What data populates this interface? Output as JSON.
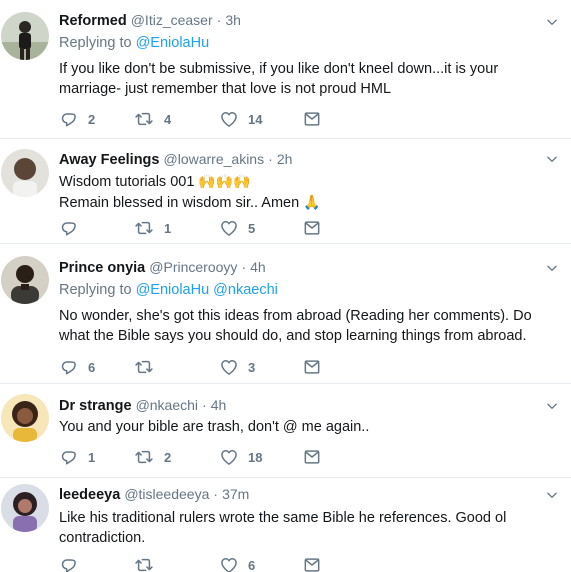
{
  "tweets": [
    {
      "name": "Reformed",
      "handle": "@Itiz_ceaser",
      "dot": "·",
      "time": "3h",
      "replying_prefix": "Replying to",
      "replying_to": "@EniolaHu",
      "text": "If you like don't be submissive, if you like don't kneel down...it is your marriage- just remember that love is not proud HML",
      "replies": "2",
      "retweets": "4",
      "likes": "14"
    },
    {
      "name": "Away Feelings",
      "handle": "@lowarre_akins",
      "dot": "·",
      "time": "2h",
      "line1": "Wisdom tutorials 001",
      "line1_emoji": "🙌🙌🙌",
      "line2": "Remain blessed in wisdom sir.. Amen",
      "line2_emoji": "🙏",
      "replies": "",
      "retweets": "1",
      "likes": "5"
    },
    {
      "name": "Prince onyia",
      "handle": "@Princerooyy",
      "dot": "·",
      "time": "4h",
      "replying_prefix": "Replying to",
      "replying_to": "@EniolaHu @nkaechi",
      "text": "No wonder, she's got this ideas from abroad (Reading her comments). Do what the Bible says you should do, and stop learning things from abroad.",
      "replies": "6",
      "retweets": "",
      "likes": "3"
    },
    {
      "name": "Dr strange",
      "handle": "@nkaechi",
      "dot": "·",
      "time": "4h",
      "text": "You and your bible are trash, don't @ me again..",
      "replies": "1",
      "retweets": "2",
      "likes": "18"
    },
    {
      "name": "leedeeya",
      "handle": "@tisleedeeya",
      "dot": "·",
      "time": "37m",
      "text": "Like his traditional rulers wrote the same Bible he references. Good ol contradiction.",
      "replies": "",
      "retweets": "",
      "likes": "6"
    }
  ],
  "icons": {
    "reply": "reply-icon",
    "retweet": "retweet-icon",
    "like": "heart-icon",
    "dm": "envelope-icon",
    "caret": "chevron-down-icon"
  },
  "colors": {
    "link": "#1da1f2",
    "muted": "#657786",
    "text": "#14171a",
    "divider": "#e6ecf0"
  }
}
